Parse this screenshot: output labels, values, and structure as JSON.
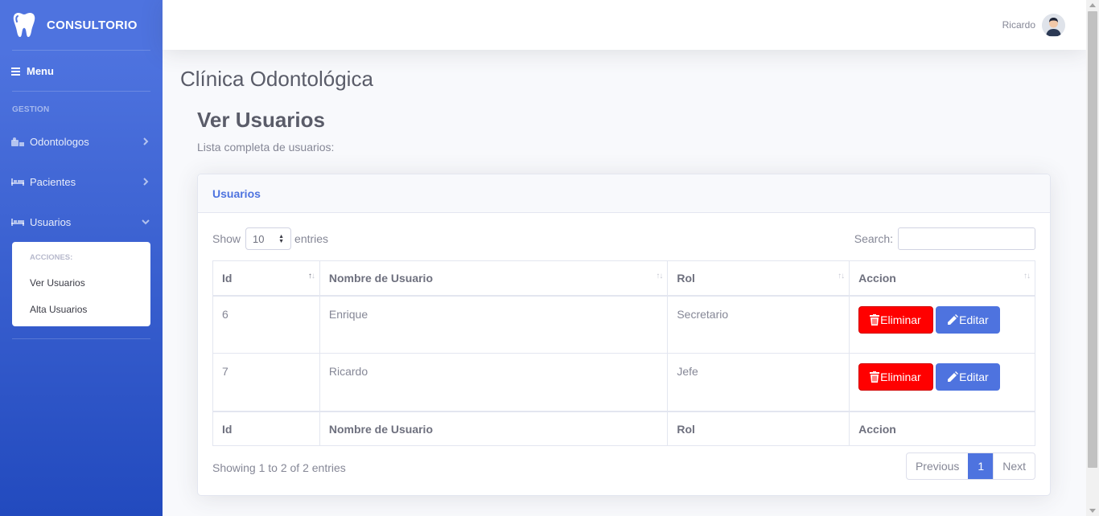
{
  "sidebar": {
    "brand": "CONSULTORIO",
    "menu_label": "Menu",
    "heading": "GESTION",
    "items": [
      {
        "label": "Odontologos",
        "icon": "doctor-icon"
      },
      {
        "label": "Pacientes",
        "icon": "bed-icon"
      },
      {
        "label": "Usuarios",
        "icon": "bed-icon"
      }
    ],
    "submenu": {
      "heading": "ACCIONES:",
      "items": [
        {
          "label": "Ver Usuarios"
        },
        {
          "label": "Alta Usuarios"
        }
      ]
    }
  },
  "topbar": {
    "user_name": "Ricardo"
  },
  "page": {
    "title": "Clínica Odontológica",
    "section_title": "Ver Usuarios",
    "section_subtitle": "Lista completa de usuarios:"
  },
  "card": {
    "header": "Usuarios",
    "length": {
      "show": "Show",
      "value": "10",
      "entries": "entries"
    },
    "search_label": "Search:",
    "columns": [
      "Id",
      "Nombre de Usuario",
      "Rol",
      "Accion"
    ],
    "rows": [
      {
        "id": "6",
        "name": "Enrique",
        "rol": "Secretario"
      },
      {
        "id": "7",
        "name": "Ricardo",
        "rol": "Jefe"
      }
    ],
    "delete_label": "Eliminar",
    "edit_label": "Editar",
    "info": "Showing 1 to 2 of 2 entries",
    "pager": {
      "previous": "Previous",
      "current": "1",
      "next": "Next"
    }
  },
  "colors": {
    "primary": "#4e73df",
    "danger": "#ff0000",
    "sidebar_end": "#224abe"
  }
}
